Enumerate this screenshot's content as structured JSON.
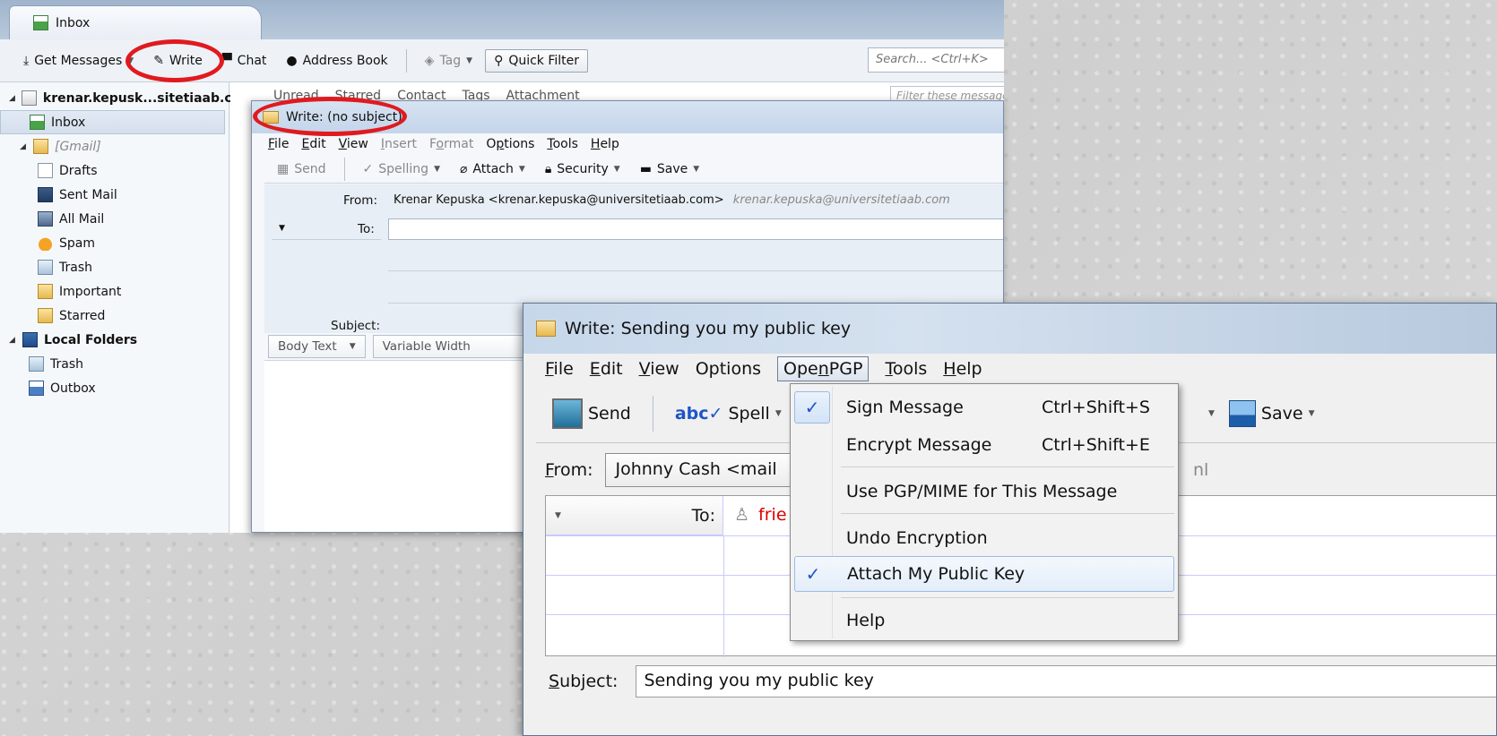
{
  "main": {
    "tab_title": "Inbox",
    "toolbar": {
      "get_messages": "Get Messages",
      "write": "Write",
      "chat": "Chat",
      "address_book": "Address Book",
      "tag": "Tag",
      "quick_filter": "Quick Filter",
      "search_placeholder": "Search... <Ctrl+K>"
    },
    "filter_bar": {
      "items": [
        "Unread",
        "Starred",
        "Contact",
        "Tags",
        "Attachment"
      ],
      "placeholder": "Filter these messages"
    },
    "folders": [
      {
        "label": "krenar.kepusk...sitetiaab.com",
        "icon": "account-icon"
      },
      {
        "label": "Inbox",
        "icon": "inbox-icon",
        "selected": true
      },
      {
        "label": "[Gmail]",
        "icon": "folder-icon"
      },
      {
        "label": "Drafts",
        "icon": "drafts-icon"
      },
      {
        "label": "Sent Mail",
        "icon": "sent-mail-icon"
      },
      {
        "label": "All Mail",
        "icon": "all-mail-icon"
      },
      {
        "label": "Spam",
        "icon": "spam-icon"
      },
      {
        "label": "Trash",
        "icon": "trash-icon"
      },
      {
        "label": "Important",
        "icon": "folder-icon"
      },
      {
        "label": "Starred",
        "icon": "folder-icon"
      },
      {
        "label": "Local Folders",
        "icon": "computer-icon"
      },
      {
        "label": "Trash",
        "icon": "trash-icon"
      },
      {
        "label": "Outbox",
        "icon": "outbox-icon"
      }
    ]
  },
  "compose1": {
    "title": "Write: (no subject)",
    "menu": [
      "File",
      "Edit",
      "View",
      "Insert",
      "Format",
      "Options",
      "Tools",
      "Help"
    ],
    "toolbar": {
      "send": "Send",
      "spelling": "Spelling",
      "attach": "Attach",
      "security": "Security",
      "save": "Save"
    },
    "from_label": "From:",
    "from_value": "Krenar Kepuska <krenar.kepuska@universitetiaab.com>",
    "from_identity": "krenar.kepuska@universitetiaab.com",
    "to_label": "To:",
    "subject_label": "Subject:",
    "format": {
      "paragraph": "Body Text",
      "font": "Variable Width"
    }
  },
  "compose2": {
    "title": "Write: Sending you my public key",
    "menu": [
      "File",
      "Edit",
      "View",
      "Options",
      "OpenPGP",
      "Tools",
      "Help"
    ],
    "toolbar": {
      "send": "Send",
      "spell": "Spell",
      "save": "Save"
    },
    "from_label": "From:",
    "from_value": "Johnny Cash <mail",
    "from_tail": "nl",
    "to_label": "To:",
    "to_value": "frie",
    "subject_label": "Subject:",
    "subject_value": "Sending you my public key"
  },
  "openpgp_menu": {
    "items": [
      {
        "label": "Sign Message",
        "shortcut": "Ctrl+Shift+S",
        "checked": true
      },
      {
        "label": "Encrypt Message",
        "shortcut": "Ctrl+Shift+E",
        "checked": false
      },
      {
        "label": "Use PGP/MIME for This Message",
        "shortcut": "",
        "checked": false
      },
      {
        "label": "Undo Encryption",
        "shortcut": "",
        "checked": false
      },
      {
        "label": "Attach My Public Key",
        "shortcut": "",
        "checked": true
      },
      {
        "label": "Help",
        "shortcut": "",
        "checked": false
      }
    ]
  },
  "colors": {
    "annotation": "#e01a1f",
    "accent": "#1e55c7"
  }
}
